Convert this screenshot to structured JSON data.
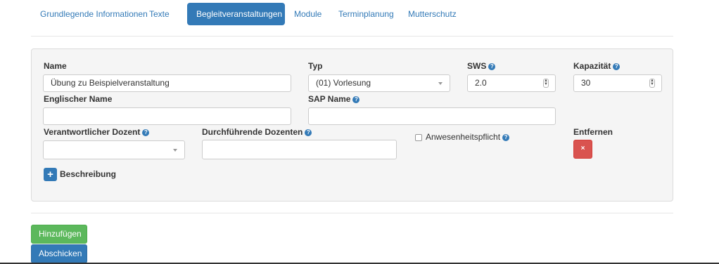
{
  "tabs": [
    {
      "label": "Grundlegende Informationen",
      "active": false
    },
    {
      "label": "Texte",
      "active": false
    },
    {
      "label": "Begleitveranstaltungen",
      "active": true
    },
    {
      "label": "Module",
      "active": false
    },
    {
      "label": "Terminplanung",
      "active": false
    },
    {
      "label": "Mutterschutz",
      "active": false
    }
  ],
  "form": {
    "name": {
      "label": "Name",
      "value": "Übung zu Beispielveranstaltung"
    },
    "typ": {
      "label": "Typ",
      "selected": "(01) Vorlesung"
    },
    "sws": {
      "label": "SWS",
      "value": "2.0"
    },
    "kapazitaet": {
      "label": "Kapazität",
      "value": "30"
    },
    "englischer_name": {
      "label": "Englischer Name",
      "value": ""
    },
    "sap_name": {
      "label": "SAP Name",
      "value": ""
    },
    "verantwortlicher_dozent": {
      "label": "Verantwortlicher Dozent",
      "selected": ""
    },
    "durchfuehrende_dozenten": {
      "label": "Durchführende Dozenten",
      "value": ""
    },
    "anwesenheitspflicht": {
      "label": "Anwesenheitspflicht",
      "checked": false
    },
    "entfernen": {
      "label": "Entfernen",
      "button_symbol": "×"
    },
    "beschreibung": {
      "label": "Beschreibung",
      "button_symbol": "+"
    }
  },
  "actions": {
    "add_label": "Hinzufügen",
    "submit_label": "Abschicken"
  },
  "icons": {
    "help": "question-circle-icon",
    "remove": "times-icon",
    "expand": "plus-icon"
  },
  "colors": {
    "primary": "#337ab7",
    "success": "#5cb85c",
    "danger": "#d9534f",
    "panel_bg": "#f5f5f5"
  }
}
